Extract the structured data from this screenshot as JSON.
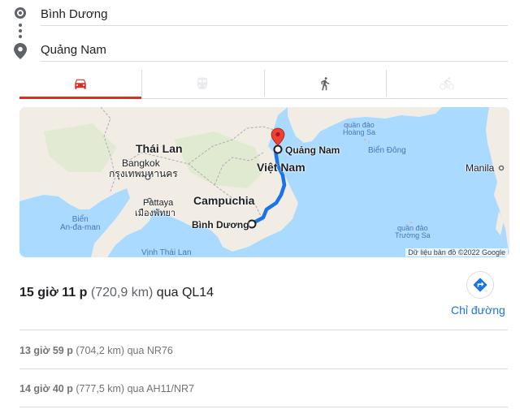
{
  "route": {
    "origin_value": "Bình Dương",
    "destination_value": "Quảng Nam"
  },
  "travel_modes": [
    {
      "icon": "car-icon",
      "active": true
    },
    {
      "icon": "transit-icon",
      "active": false
    },
    {
      "icon": "walk-icon",
      "active": false
    },
    {
      "icon": "bicycle-icon",
      "active": false
    }
  ],
  "map": {
    "labels": {
      "thai_lan": "Thái Lan",
      "bangkok": "Bangkok",
      "bangkok_local": "กรุงเทพมหานคร",
      "pattaya": "Pattaya",
      "pattaya_local": "เมืองพัทยา",
      "campuchia": "Campuchia",
      "viet_nam": "Việt Nam",
      "quang_nam": "Quảng Nam",
      "binh_duong": "Bình Dương",
      "hoang_sa": "quần đảo\nHoàng Sa",
      "truong_sa": "quần đảo\nTrường Sa",
      "bien_dong": "Biển Đông",
      "manila": "Manila",
      "bien_andaman": "Biển\nAn-đa-man",
      "vinh_thai_lan": "Vịnh Thái Lan"
    },
    "attribution": "Dữ liệu bản đồ ©2022 Google",
    "colors": {
      "water": "#aadaff",
      "land": "#f1ede4",
      "route": "#1a73e8",
      "pin": "#ea4335"
    }
  },
  "primary_route": {
    "duration": "15 giờ 11 p",
    "distance": "(720,9 km)",
    "via": "qua QL14"
  },
  "directions_button": {
    "label": "Chỉ đường",
    "icon": "directions-icon"
  },
  "alternatives": [
    {
      "duration": "13 giờ 59 p",
      "distance": "(704,2 km)",
      "via": "qua NR76"
    },
    {
      "duration": "14 giờ 40 p",
      "distance": "(777,5 km)",
      "via": "qua AH11/NR7"
    }
  ]
}
